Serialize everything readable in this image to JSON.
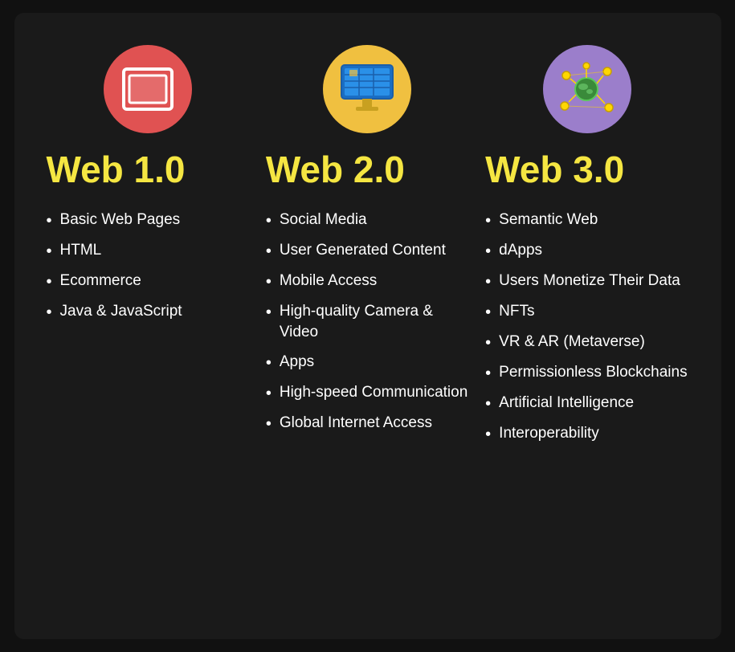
{
  "columns": [
    {
      "id": "web1",
      "icon_type": "browser",
      "icon_bg": "red",
      "title": "Web 1.0",
      "items": [
        "Basic Web Pages",
        "HTML",
        "Ecommerce",
        "Java & JavaScript"
      ]
    },
    {
      "id": "web2",
      "icon_type": "monitor",
      "icon_bg": "yellow",
      "title": "Web 2.0",
      "items": [
        "Social Media",
        "User Generated Content",
        "Mobile Access",
        "High-quality Camera & Video",
        "Apps",
        "High-speed Communication",
        "Global Internet Access"
      ]
    },
    {
      "id": "web3",
      "icon_type": "network",
      "icon_bg": "purple",
      "title": "Web 3.0",
      "items": [
        "Semantic Web",
        "dApps",
        "Users Monetize Their Data",
        "NFTs",
        "VR & AR (Metaverse)",
        "Permissionless Blockchains",
        "Artificial Intelligence",
        "Interoperability"
      ]
    }
  ]
}
